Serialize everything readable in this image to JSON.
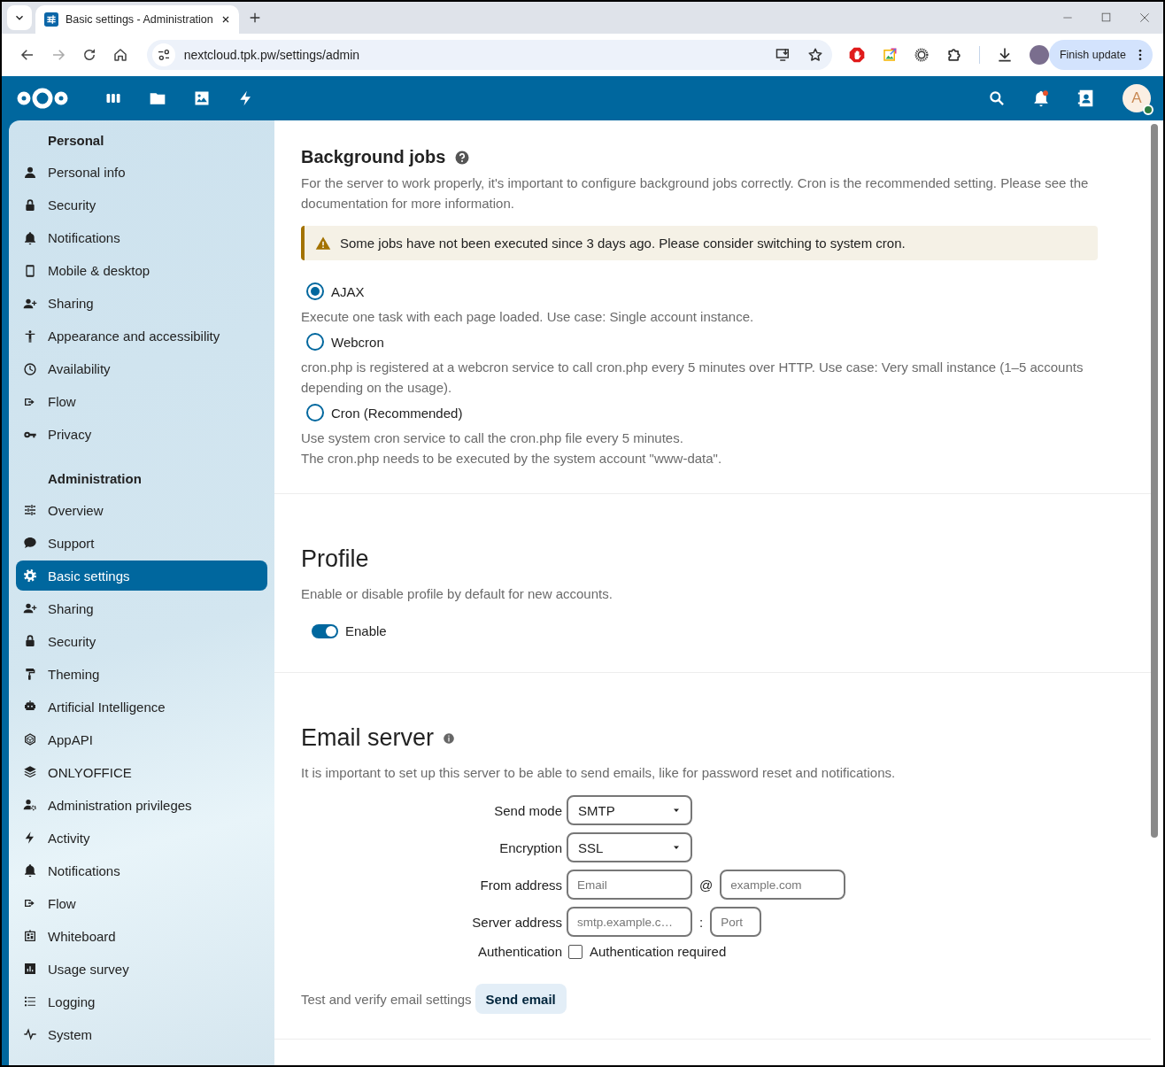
{
  "browser": {
    "tabs": [
      {
        "title": "Basic settings - Administration",
        "selected": true
      }
    ],
    "url": "nextcloud.tpk.pw/settings/admin",
    "update_button": "Finish update"
  },
  "header": {
    "avatar_initial": "A"
  },
  "sidebar": {
    "sections": [
      {
        "heading": "Personal",
        "items": [
          {
            "label": "Personal info",
            "selected": false
          },
          {
            "label": "Security",
            "selected": false
          },
          {
            "label": "Notifications",
            "selected": false
          },
          {
            "label": "Mobile & desktop",
            "selected": false
          },
          {
            "label": "Sharing",
            "selected": false
          },
          {
            "label": "Appearance and accessibility",
            "selected": false
          },
          {
            "label": "Availability",
            "selected": false
          },
          {
            "label": "Flow",
            "selected": false
          },
          {
            "label": "Privacy",
            "selected": false
          }
        ]
      },
      {
        "heading": "Administration",
        "items": [
          {
            "label": "Overview",
            "selected": false
          },
          {
            "label": "Support",
            "selected": false
          },
          {
            "label": "Basic settings",
            "selected": true
          },
          {
            "label": "Sharing",
            "selected": false
          },
          {
            "label": "Security",
            "selected": false
          },
          {
            "label": "Theming",
            "selected": false
          },
          {
            "label": "Artificial Intelligence",
            "selected": false
          },
          {
            "label": "AppAPI",
            "selected": false
          },
          {
            "label": "ONLYOFFICE",
            "selected": false
          },
          {
            "label": "Administration privileges",
            "selected": false
          },
          {
            "label": "Activity",
            "selected": false
          },
          {
            "label": "Notifications",
            "selected": false
          },
          {
            "label": "Flow",
            "selected": false
          },
          {
            "label": "Whiteboard",
            "selected": false
          },
          {
            "label": "Usage survey",
            "selected": false
          },
          {
            "label": "Logging",
            "selected": false
          },
          {
            "label": "System",
            "selected": false
          }
        ]
      }
    ]
  },
  "background_jobs": {
    "title": "Background jobs",
    "description": "For the server to work properly, it's important to configure background jobs correctly. Cron is the recommended setting. Please see the documentation for more information.",
    "warning": "Some jobs have not been executed since 3 days ago. Please consider switching to system cron.",
    "options": [
      {
        "label": "AJAX",
        "selected": true,
        "description": [
          "Execute one task with each page loaded. Use case: Single account instance."
        ]
      },
      {
        "label": "Webcron",
        "selected": false,
        "description": [
          "cron.php is registered at a webcron service to call cron.php every 5 minutes over HTTP. Use case: Very small instance (1–5 accounts depending on the usage)."
        ]
      },
      {
        "label": "Cron (Recommended)",
        "selected": false,
        "description": [
          "Use system cron service to call the cron.php file every 5 minutes.",
          "The cron.php needs to be executed by the system account \"www-data\"."
        ]
      }
    ]
  },
  "profile": {
    "title": "Profile",
    "description": "Enable or disable profile by default for new accounts.",
    "toggle": {
      "label": "Enable",
      "on": true
    }
  },
  "email_server": {
    "title": "Email server",
    "description": "It is important to set up this server to be able to send emails, like for password reset and notifications.",
    "rows": [
      {
        "kind": "select",
        "label": "Send mode",
        "value": "SMTP"
      },
      {
        "kind": "select",
        "label": "Encryption",
        "value": "SSL"
      },
      {
        "kind": "pair",
        "label": "From address",
        "fields": [
          {
            "placeholder": "Email"
          },
          {
            "placeholder": "example.com"
          }
        ],
        "separator": "@"
      },
      {
        "kind": "pair",
        "label": "Server address",
        "fields": [
          {
            "placeholder": "smtp.example.c…"
          },
          {
            "placeholder": "Port"
          }
        ],
        "separator": ":"
      },
      {
        "kind": "checkbox",
        "label": "Authentication",
        "checked": false,
        "text": "Authentication required"
      }
    ],
    "test": {
      "text": "Test and verify email settings",
      "button": "Send email"
    }
  }
}
